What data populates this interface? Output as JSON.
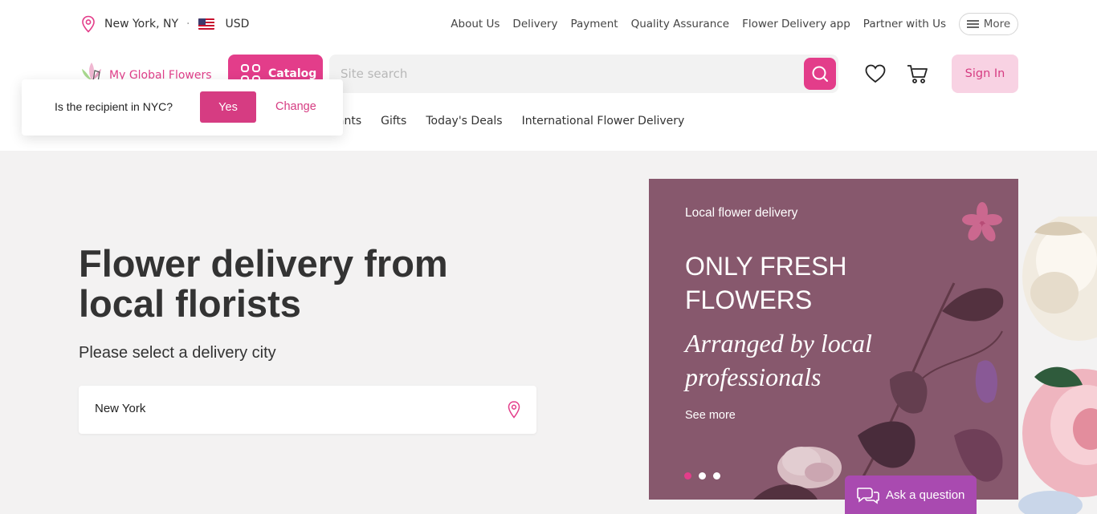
{
  "location": {
    "city": "New York, NY",
    "currency": "USD"
  },
  "top_nav": [
    "About Us",
    "Delivery",
    "Payment",
    "Quality Assurance",
    "Flower Delivery app",
    "Partner with Us"
  ],
  "more_label": "More",
  "brand": {
    "name": "My Global Flowers"
  },
  "catalog_label": "Catalog",
  "search": {
    "placeholder": "Site search",
    "value": ""
  },
  "sign_in_label": "Sign In",
  "sub_nav": [
    "lants",
    "Gifts",
    "Today's Deals",
    "International Flower Delivery"
  ],
  "popup": {
    "question": "Is the recipient in NYC?",
    "yes_label": "Yes",
    "change_label": "Change"
  },
  "hero": {
    "title": "Flower delivery from local florists",
    "subtitle": "Please select a delivery city",
    "city_value": "New York"
  },
  "banner": {
    "eyebrow": "Local flower delivery",
    "headline": "ONLY FRESH FLOWERS",
    "tagline": "Arranged by local professionals",
    "link": "See more",
    "slides": 3,
    "active_slide": 1,
    "background": "#87586d"
  },
  "chat": {
    "label": "Ask a question"
  },
  "colors": {
    "accent": "#e33d8a",
    "accent_light": "#f8d2e3",
    "chat": "#a94ab0"
  },
  "icons": [
    "location-pin-icon",
    "us-flag-icon",
    "menu-icon",
    "logo-icon",
    "grid-icon",
    "search-icon",
    "heart-icon",
    "cart-icon",
    "chat-icon"
  ]
}
